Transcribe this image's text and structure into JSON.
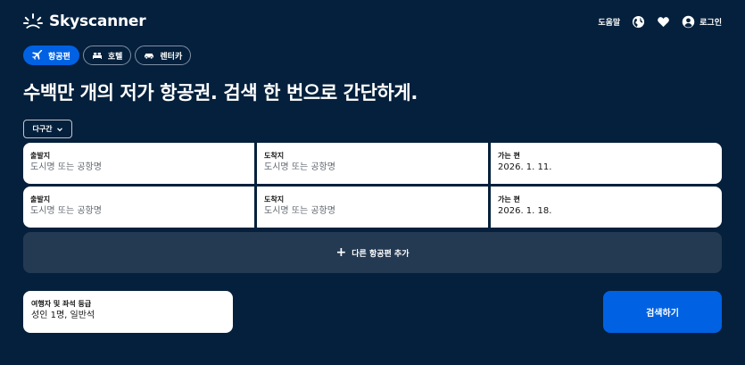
{
  "brand": {
    "name": "Skyscanner",
    "logo_icon": "skyscanner-sunrise-icon"
  },
  "header": {
    "help_label": "도움말",
    "region_icon": "globe-icon",
    "favorites_icon": "heart-icon",
    "login_icon": "user-icon",
    "login_label": "로그인"
  },
  "tabs": [
    {
      "label": "항공편",
      "icon": "plane-icon",
      "active": true
    },
    {
      "label": "호텔",
      "icon": "bed-icon",
      "active": false
    },
    {
      "label": "렌터카",
      "icon": "car-icon",
      "active": false
    }
  ],
  "headline": "수백만 개의 저가 항공권. 검색 한 번으로 간단하게.",
  "trip_type": {
    "selected": "다구간",
    "icon": "chevron-down-icon"
  },
  "legs": [
    {
      "origin": {
        "label": "출발지",
        "placeholder": "도시명 또는 공항명"
      },
      "destination": {
        "label": "도착지",
        "placeholder": "도시명 또는 공항명"
      },
      "depart": {
        "label": "가는 편",
        "value": "2026. 1. 11."
      }
    },
    {
      "origin": {
        "label": "출발지",
        "placeholder": "도시명 또는 공항명"
      },
      "destination": {
        "label": "도착지",
        "placeholder": "도시명 또는 공항명"
      },
      "depart": {
        "label": "가는 편",
        "value": "2026. 1. 18."
      }
    }
  ],
  "add_leg": {
    "label": "다른 항공편 추가",
    "icon": "plus-icon"
  },
  "travellers": {
    "label": "여행자 및 좌석 등급",
    "value": "성인 1명, 일반석"
  },
  "search_button": {
    "label": "검색하기"
  },
  "colors": {
    "background": "#05203c",
    "primary": "#0062e3",
    "add_leg_bg": "#243a52",
    "field_bg": "#ffffff",
    "placeholder_text": "#626971"
  }
}
